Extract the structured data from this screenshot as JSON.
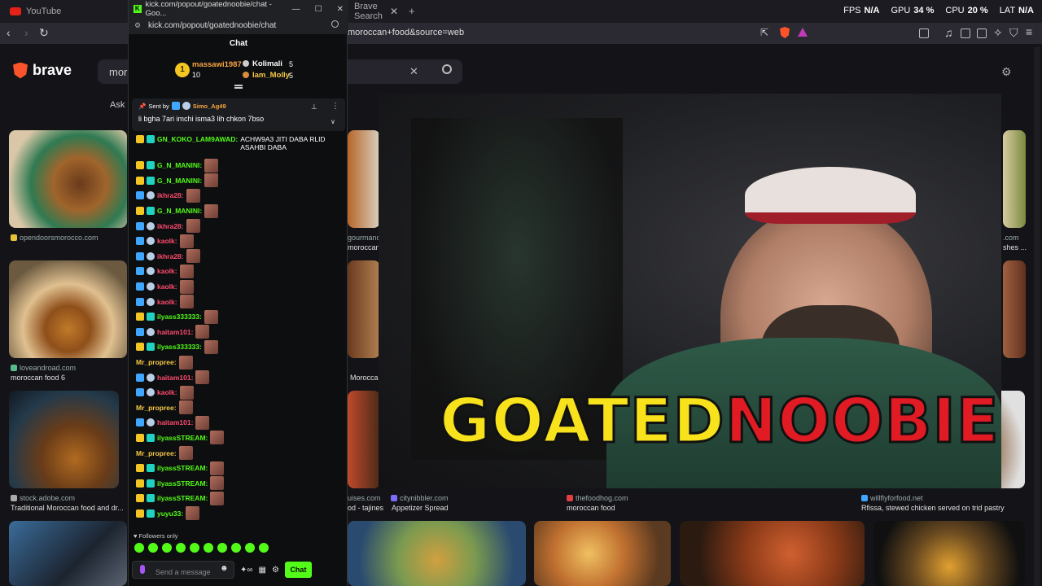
{
  "tabs": {
    "first": "YouTube",
    "second": "Brave Search"
  },
  "stats": {
    "fps_label": "FPS",
    "fps": "N/A",
    "gpu_label": "GPU",
    "gpu": "34 %",
    "cpu_label": "CPU",
    "cpu": "20 %",
    "lat_label": "LAT",
    "lat": "N/A"
  },
  "browser": {
    "url": "moroccan+food&source=web"
  },
  "search": {
    "brand": "brave",
    "query": "mor",
    "ask_label": "Ask"
  },
  "results": [
    {
      "source": "opendoorsmorocco.com",
      "title": ""
    },
    {
      "source": "loveandroad.com",
      "title": "moroccan food 6"
    },
    {
      "source": "stock.adobe.com",
      "title": "Traditional Moroccan food and dr..."
    },
    {
      "source": "gourmand",
      "title": "moroccan food"
    },
    {
      "source": "",
      "title": "Moroccan"
    },
    {
      "source": "uises.com",
      "title": "od - tajines"
    },
    {
      "source": "citynibbler.com",
      "title": "Appetizer Spread"
    },
    {
      "source": "thefoodhog.com",
      "title": "moroccan food"
    },
    {
      "source": "willflyforfood.net",
      "title": "Rfissa, stewed chicken served on trid pastry"
    },
    {
      "source": ".com",
      "title": "shes ..."
    }
  ],
  "popup": {
    "title": "kick.com/popout/goatednoobie/chat - Goo...",
    "url": "kick.com/popout/goatednoobie/chat",
    "chat_heading": "Chat",
    "leaderboard": {
      "rank": "1",
      "first_name": "massawi1987",
      "first_count": "10",
      "second_name": "Kolimali",
      "second_count": "5",
      "third_name": "Iam_Molly",
      "third_count": "5"
    },
    "pinned": {
      "sent_by": "Sent by",
      "user": "Simo_Ag49",
      "message": "li bgha 7ari imchi isma3 lih chkon 7bso"
    },
    "messages": [
      {
        "user": "GN_KOKO_LAM9AWAD",
        "color": "#53fc18",
        "text": "ACHW9A3 JITI DABA RLID ASAHBI DABA"
      },
      {
        "user": "G_N_MANINI",
        "color": "#53fc18",
        "text": ""
      },
      {
        "user": "G_N_MANINI",
        "color": "#53fc18",
        "text": ""
      },
      {
        "user": "ikhra28",
        "color": "#ff4b6e",
        "text": ""
      },
      {
        "user": "G_N_MANINI",
        "color": "#53fc18",
        "text": ""
      },
      {
        "user": "ikhra28",
        "color": "#ff4b6e",
        "text": ""
      },
      {
        "user": "kaolk",
        "color": "#ff4b6e",
        "text": ""
      },
      {
        "user": "ikhra28",
        "color": "#ff4b6e",
        "text": ""
      },
      {
        "user": "kaolk",
        "color": "#ff4b6e",
        "text": ""
      },
      {
        "user": "kaolk",
        "color": "#ff4b6e",
        "text": ""
      },
      {
        "user": "kaolk",
        "color": "#ff4b6e",
        "text": ""
      },
      {
        "user": "ilyass333333",
        "color": "#53fc18",
        "text": ""
      },
      {
        "user": "haitam101",
        "color": "#ff4b6e",
        "text": ""
      },
      {
        "user": "ilyass333333",
        "color": "#53fc18",
        "text": ""
      },
      {
        "user": "Mr_propree",
        "color": "#f7c945",
        "text": ""
      },
      {
        "user": "haitam101",
        "color": "#ff4b6e",
        "text": ""
      },
      {
        "user": "kaolk",
        "color": "#ff4b6e",
        "text": ""
      },
      {
        "user": "Mr_propree",
        "color": "#f7c945",
        "text": ""
      },
      {
        "user": "haitam101",
        "color": "#ff4b6e",
        "text": ""
      },
      {
        "user": "ilyassSTREAM",
        "color": "#53fc18",
        "text": ""
      },
      {
        "user": "Mr_propree",
        "color": "#f7c945",
        "text": ""
      },
      {
        "user": "ilyassSTREAM",
        "color": "#53fc18",
        "text": ""
      },
      {
        "user": "ilyassSTREAM",
        "color": "#53fc18",
        "text": ""
      },
      {
        "user": "ilyassSTREAM",
        "color": "#53fc18",
        "text": ""
      },
      {
        "user": "yuyu33",
        "color": "#53fc18",
        "text": ""
      }
    ],
    "followers_only": "Followers only",
    "input_placeholder": "Send a message",
    "chat_button": "Chat"
  },
  "overlay": {
    "logo_part1": "GOATED",
    "logo_part2": "NOOBIE"
  },
  "colors": {
    "kick_green": "#53fc18",
    "logo_yellow": "#f7e21c",
    "logo_red": "#e01b24",
    "brave_orange": "#fb542b"
  }
}
